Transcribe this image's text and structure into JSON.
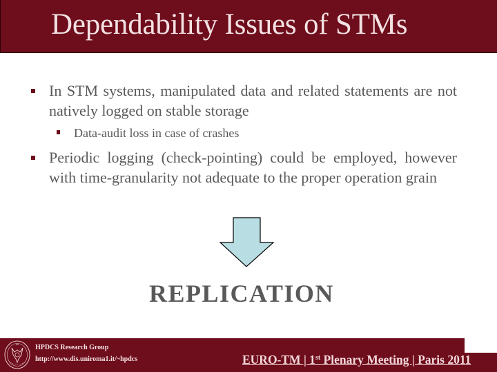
{
  "slide": {
    "title": "Dependability Issues of STMs",
    "bullets": [
      {
        "level": 1,
        "text": "In STM systems, manipulated data and related statements are not natively logged on stable storage"
      },
      {
        "level": 2,
        "text": "Data-audit loss in case of crashes"
      },
      {
        "level": 1,
        "text": "Periodic logging (check-pointing) could be employed, however with time-granularity not adequate to the proper operation grain"
      }
    ],
    "arrow_icon": "down-arrow-icon",
    "conclusion": "REPLICATION"
  },
  "footer": {
    "logo_icon": "university-seal-icon",
    "group_name": "HPDCS Research Group",
    "group_url": "http://www.dis.uniroma1.it/~hpdcs",
    "event_prefix": "EURO-TM | 1",
    "event_superscript": "st",
    "event_suffix": " Plenary Meeting | Paris 2011"
  },
  "colors": {
    "brand": "#6e0d1b",
    "title_text": "#f3e1e3",
    "body_text": "#595959",
    "arrow_fill": "#b8dde3"
  }
}
